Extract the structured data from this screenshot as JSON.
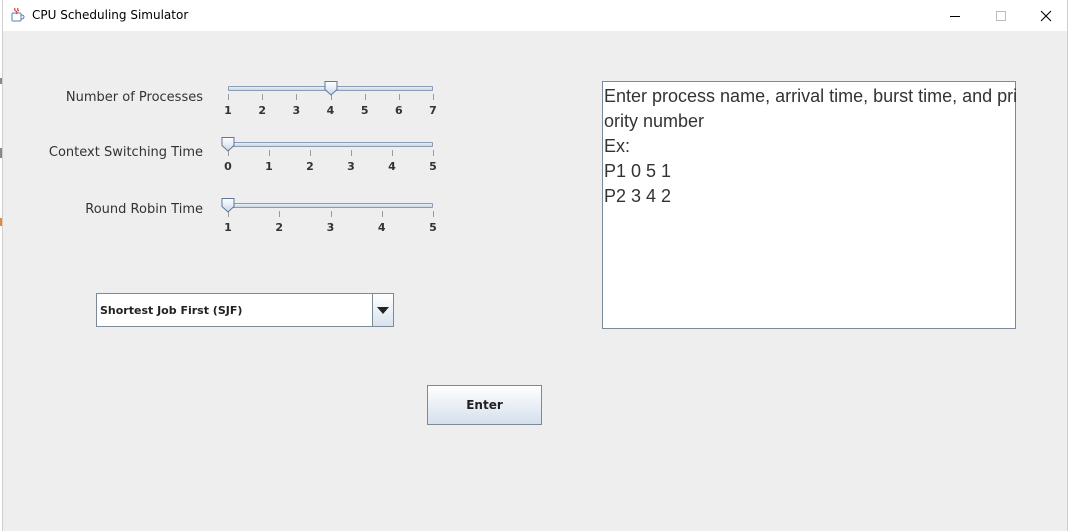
{
  "window": {
    "title": "CPU Scheduling Simulator",
    "controls": {
      "minimize": "—",
      "maximize": "☐",
      "close": "✕"
    }
  },
  "sliders": [
    {
      "label": "Number of Processes",
      "min": 1,
      "max": 7,
      "value": 4,
      "ticks": [
        "1",
        "2",
        "3",
        "4",
        "5",
        "6",
        "7"
      ]
    },
    {
      "label": "Context Switching Time",
      "min": 0,
      "max": 5,
      "value": 0,
      "ticks": [
        "0",
        "1",
        "2",
        "3",
        "4",
        "5"
      ]
    },
    {
      "label": "Round Robin Time",
      "min": 1,
      "max": 5,
      "value": 1,
      "ticks": [
        "1",
        "2",
        "3",
        "4",
        "5"
      ]
    }
  ],
  "algorithm_select": {
    "selected": "Shortest Job First (SJF)"
  },
  "input_area": {
    "lines": [
      "Enter process name, arrival time, burst time, and pri",
      "ority number",
      "Ex:",
      "P1 0 5 1",
      "P2 3 4 2"
    ]
  },
  "enter_button": {
    "label": "Enter"
  },
  "colors": {
    "background": "#eeeeee",
    "accent_border": "#7a8a99",
    "button_gradient_bottom": "#d5e0ec"
  },
  "icons": {
    "app": "java-cup-icon",
    "combo": "triangle-down-icon"
  }
}
